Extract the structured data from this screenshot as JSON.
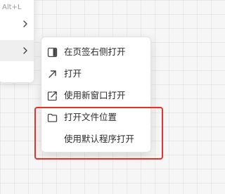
{
  "parent_menu": {
    "shortcut_text": "Alt+L",
    "rows": [
      {
        "icon": "chevron-right-icon"
      },
      {
        "icon": "chevron-right-icon",
        "hovered": true
      }
    ]
  },
  "submenu": {
    "items": [
      {
        "label": "在页签右侧打开",
        "icon": "split-right-icon"
      },
      {
        "label": "打开",
        "icon": "arrow-up-right-icon"
      },
      {
        "label": "使用新窗口打开",
        "icon": "external-window-icon"
      },
      {
        "label": "打开文件位置",
        "icon": "folder-icon"
      },
      {
        "label": "使用默认程序打开",
        "icon": ""
      }
    ]
  },
  "annotation": {
    "color": "#e5322d"
  }
}
